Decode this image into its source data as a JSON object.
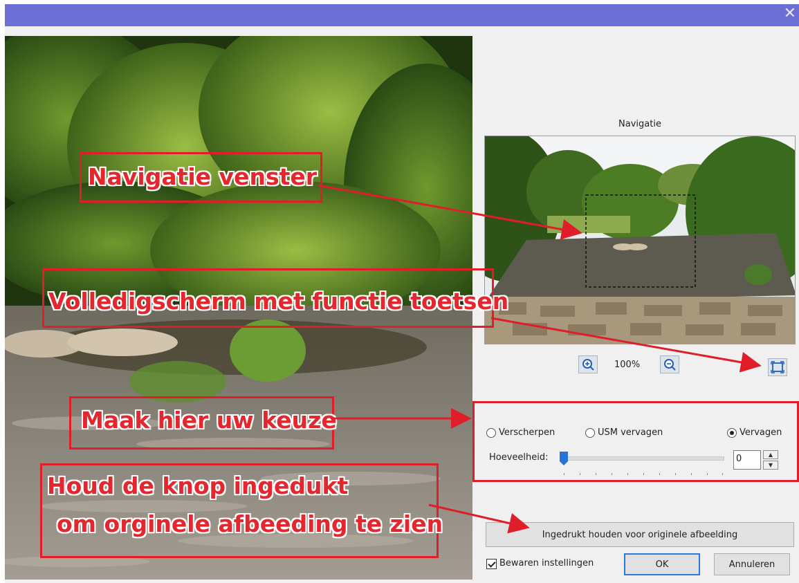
{
  "window": {
    "close_glyph": "✕"
  },
  "navigation": {
    "title": "Navigatie",
    "zoom_level": "100%",
    "zoom_in_icon": "zoom-in-icon",
    "zoom_out_icon": "zoom-out-icon",
    "fullscreen_icon": "fullscreen-icon"
  },
  "options": {
    "radio_sharpen": "Verscherpen",
    "radio_usm_blur": "USM vervagen",
    "radio_blur": "Vervagen",
    "selected": "Vervagen",
    "amount_label": "Hoeveelheid:",
    "amount_value": "0",
    "slider_fraction": 0
  },
  "buttons": {
    "hold_original": "Ingedrukt houden voor originele afbeelding",
    "save_settings": "Bewaren instellingen",
    "ok": "OK",
    "cancel": "Annuleren"
  },
  "annotations": {
    "nav_window": "Navigatie venster",
    "fullscreen": "Volledigscherm met functie toetsen",
    "choose": "Maak hier uw keuze",
    "hold_line1": "Houd de knop ingedukt",
    "hold_line2": "om orginele afbeeding te zien"
  },
  "colors": {
    "titlebar": "#6d6fd4",
    "annotation_red": "#e01e2a",
    "accent_blue": "#2574d6"
  }
}
